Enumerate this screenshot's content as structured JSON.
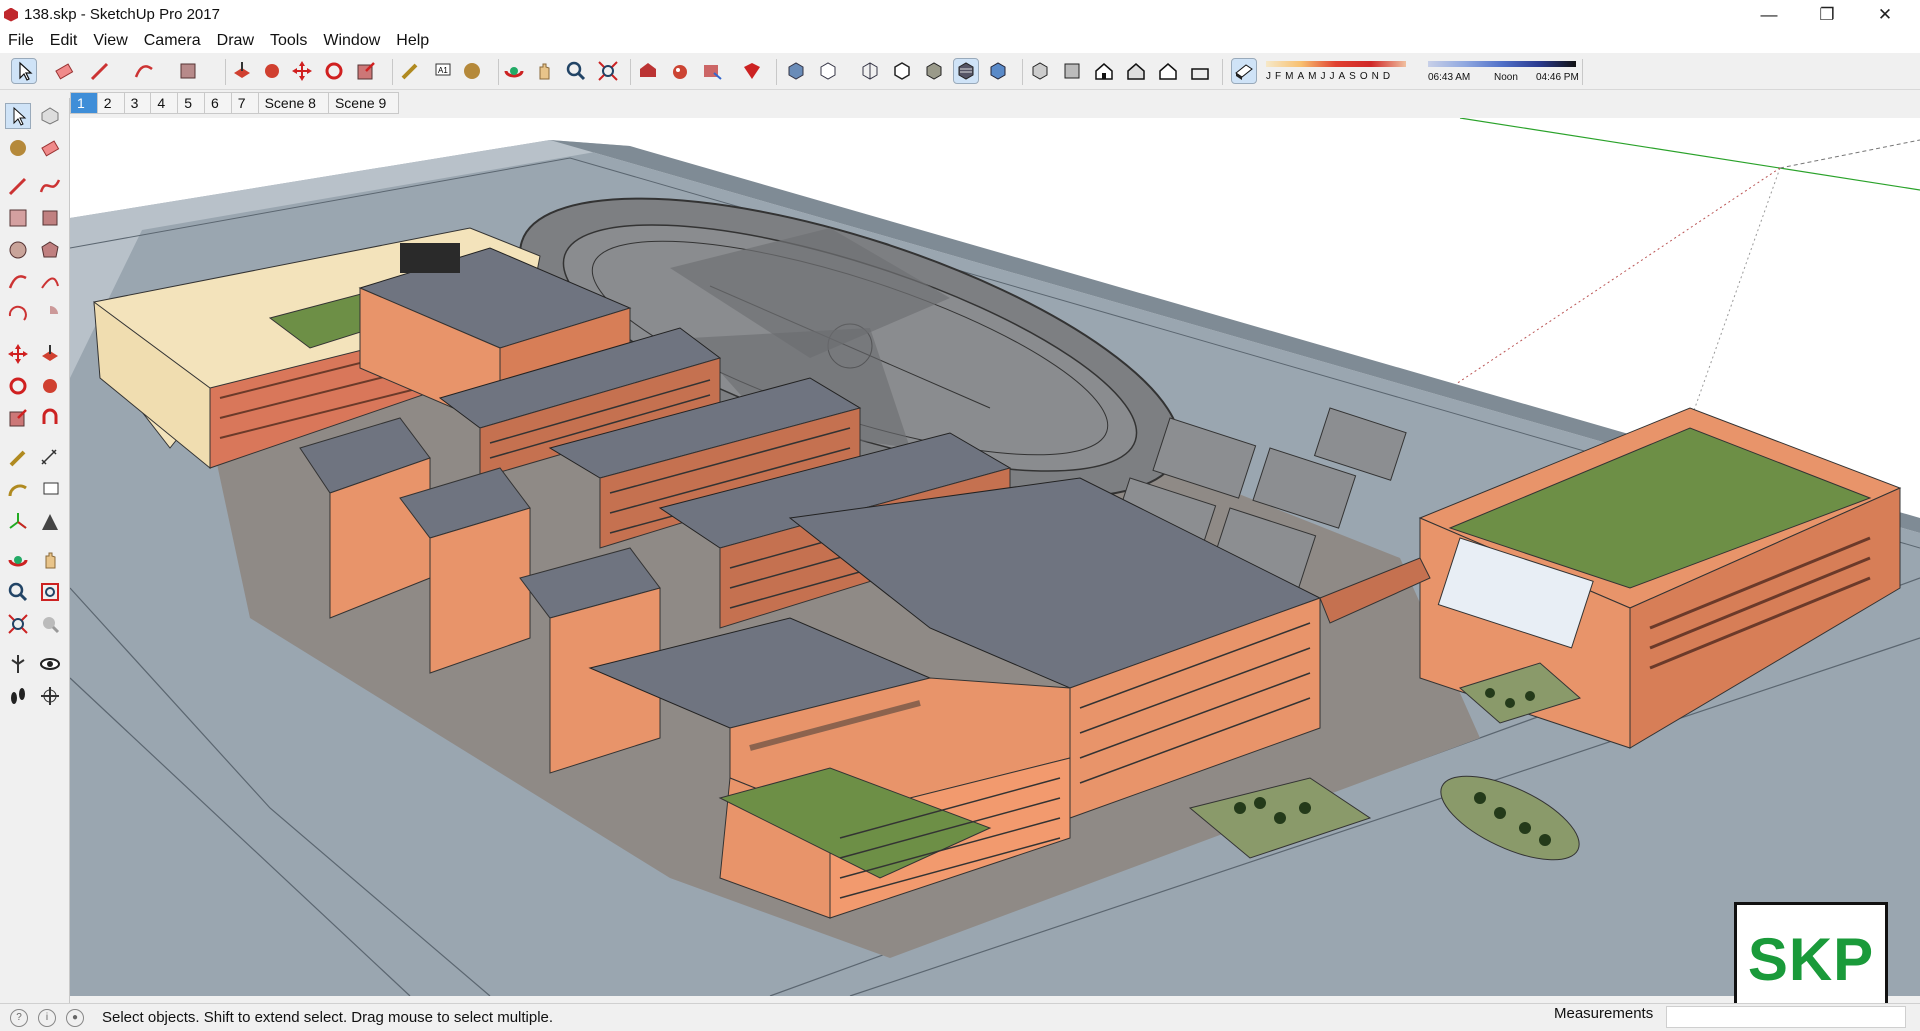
{
  "window": {
    "title": "138.skp - SketchUp Pro 2017"
  },
  "menus": [
    "File",
    "Edit",
    "View",
    "Camera",
    "Draw",
    "Tools",
    "Window",
    "Help"
  ],
  "shadow_toolbar": {
    "months": [
      "J",
      "F",
      "M",
      "A",
      "M",
      "J",
      "J",
      "A",
      "S",
      "O",
      "N",
      "D"
    ],
    "time_start": "06:43 AM",
    "time_mid": "Noon",
    "time_end": "04:46 PM"
  },
  "scenes": [
    "1",
    "2",
    "3",
    "4",
    "5",
    "6",
    "7",
    "Scene 8",
    "Scene 9"
  ],
  "status": {
    "message": "Select objects. Shift to extend select. Drag mouse to select multiple.",
    "measurements_label": "Measurements",
    "measurements_value": ""
  },
  "watermark": {
    "text": "SKP"
  },
  "colors": {
    "accent": "#3f8ed8",
    "facade": "#e8946a",
    "roof": "#6f7480",
    "green_roof": "#6d8f46",
    "ground": "#9aa6b0"
  }
}
